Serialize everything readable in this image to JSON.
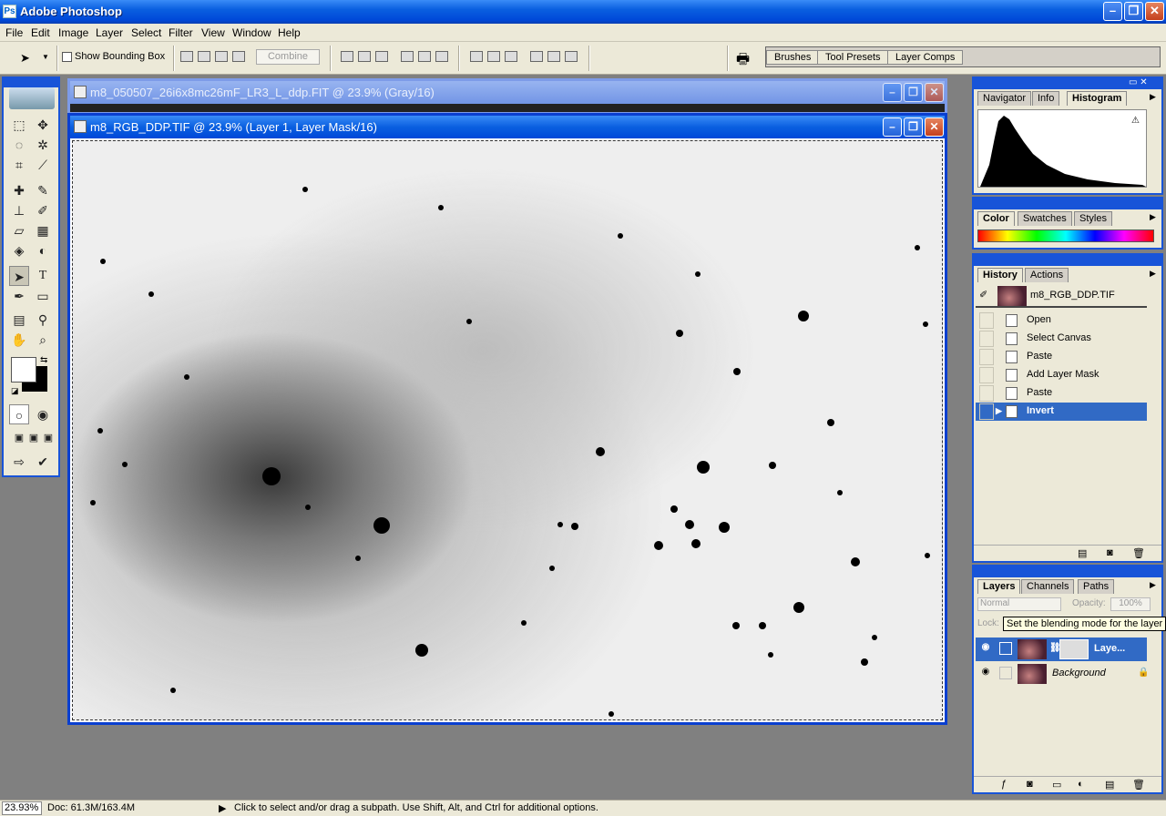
{
  "app": {
    "title": "Adobe Photoshop"
  },
  "menu": [
    "File",
    "Edit",
    "Image",
    "Layer",
    "Select",
    "Filter",
    "View",
    "Window",
    "Help"
  ],
  "options": {
    "bounding_box_label": "Show Bounding Box",
    "combine_label": "Combine",
    "dock_tabs": [
      "Brushes",
      "Tool Presets",
      "Layer Comps"
    ]
  },
  "documents": [
    {
      "title": "m8_050507_26i6x8mc26mF_LR3_L_ddp.FIT @ 23.9% (Gray/16)"
    },
    {
      "title": "m8_RGB_DDP.TIF @ 23.9% (Layer 1, Layer Mask/16)"
    }
  ],
  "panels": {
    "navigator": {
      "tabs": [
        "Navigator",
        "Info",
        "Histogram"
      ],
      "active": "Histogram"
    },
    "color": {
      "tabs": [
        "Color",
        "Swatches",
        "Styles"
      ],
      "active": "Color"
    },
    "history": {
      "tabs": [
        "History",
        "Actions"
      ],
      "active": "History",
      "snapshot": "m8_RGB_DDP.TIF",
      "steps": [
        "Open",
        "Select Canvas",
        "Paste",
        "Add Layer Mask",
        "Paste",
        "Invert"
      ],
      "selected": "Invert"
    },
    "layers": {
      "tabs": [
        "Layers",
        "Channels",
        "Paths"
      ],
      "active": "Layers",
      "blend_mode": "Normal",
      "opacity_label": "Opacity:",
      "opacity": "100%",
      "lock_label": "Lock:",
      "tooltip": "Set the blending mode for the layer",
      "items": [
        {
          "name": "Laye...",
          "selected": true
        },
        {
          "name": "Background",
          "selected": false
        }
      ]
    }
  },
  "status": {
    "zoom": "23.93%",
    "doc": "Doc: 61.3M/163.4M",
    "message": "Click to select and/or drag a subpath.  Use Shift, Alt, and Ctrl for additional options."
  },
  "colors": {
    "titlebar": "#0a5fe0",
    "selection": "#316ac5",
    "chrome": "#ece9d8"
  }
}
